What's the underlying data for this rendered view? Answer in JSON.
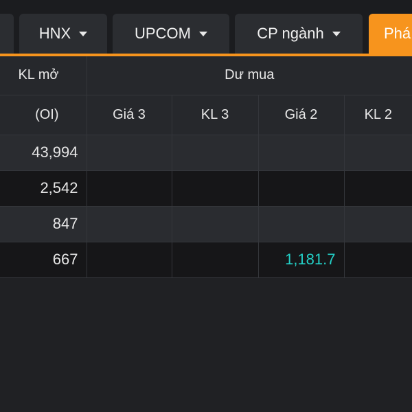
{
  "tabs": [
    {
      "label": "",
      "has_caret": false
    },
    {
      "label": "HNX",
      "has_caret": true
    },
    {
      "label": "UPCOM",
      "has_caret": true
    },
    {
      "label": "CP ngành",
      "has_caret": true
    },
    {
      "label": "Phá",
      "has_caret": false,
      "active": true
    }
  ],
  "table": {
    "oi_header_line1": "KL mở",
    "oi_header_line2": "(OI)",
    "group_header": "Dư mua",
    "sub_headers": [
      "Giá 3",
      "KL 3",
      "Giá 2",
      "KL 2"
    ],
    "rows": [
      {
        "oi": "43,994",
        "gia3": "",
        "kl3": "",
        "gia2": "",
        "kl2": ""
      },
      {
        "oi": "2,542",
        "gia3": "",
        "kl3": "",
        "gia2": "",
        "kl2": ""
      },
      {
        "oi": "847",
        "gia3": "",
        "kl3": "",
        "gia2": "",
        "kl2": ""
      },
      {
        "oi": "667",
        "gia3": "",
        "kl3": "",
        "gia2": "1,181.7",
        "kl2": ""
      }
    ]
  },
  "colors": {
    "accent": "#f7941d",
    "price_up": "#23d1c8",
    "background": "#202124"
  }
}
